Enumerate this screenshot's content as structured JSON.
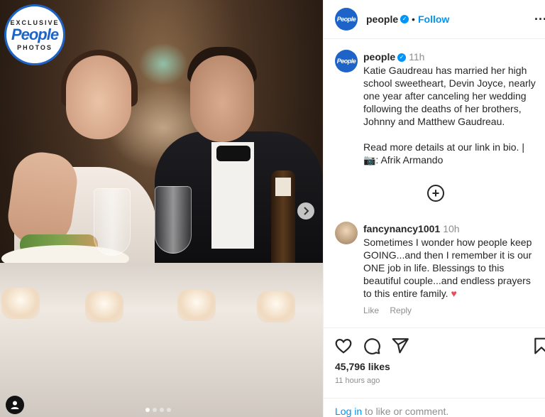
{
  "brand": {
    "badge_top": "EXCLUSIVE",
    "badge_logo": "People",
    "badge_bottom": "PHOTOS",
    "avatar_text": "People",
    "accent": "#1e64c8"
  },
  "header": {
    "username": "people",
    "verified_icon": "verified-badge-icon",
    "separator": "•",
    "follow_label": "Follow",
    "more_label": "..."
  },
  "caption": {
    "username": "people",
    "time": "11h",
    "paragraph1": "Katie Gaudreau has married her high school sweetheart, Devin Joyce, nearly one year after canceling her wedding following the deaths of her brothers, Johnny and Matthew Gaudreau.",
    "paragraph2": "Read more details at our link in bio. | 📷: Afrik Armando"
  },
  "add_comment_label": "+",
  "comment": {
    "username": "fancynancy1001",
    "time": "10h",
    "text": "Sometimes I wonder how people keep GOING...and then I remember it is our ONE job in life. Blessings to this beautiful couple...and endless prayers to this entire family.",
    "emoji": "♥",
    "like_label": "Like",
    "reply_label": "Reply"
  },
  "actions": {
    "like_icon": "heart-icon",
    "comment_icon": "comment-icon",
    "share_icon": "share-icon",
    "save_icon": "bookmark-icon"
  },
  "stats": {
    "likes": "45,796 likes",
    "posted_ago": "11 hours ago"
  },
  "login": {
    "link_label": "Log in",
    "rest_text": "to like or comment."
  },
  "carousel": {
    "next_icon": "chevron-right-icon",
    "dot_count": 4,
    "active_dot": 1
  },
  "colors": {
    "link_blue": "#0095f6",
    "muted": "#8e8e8e",
    "text": "#262626"
  }
}
